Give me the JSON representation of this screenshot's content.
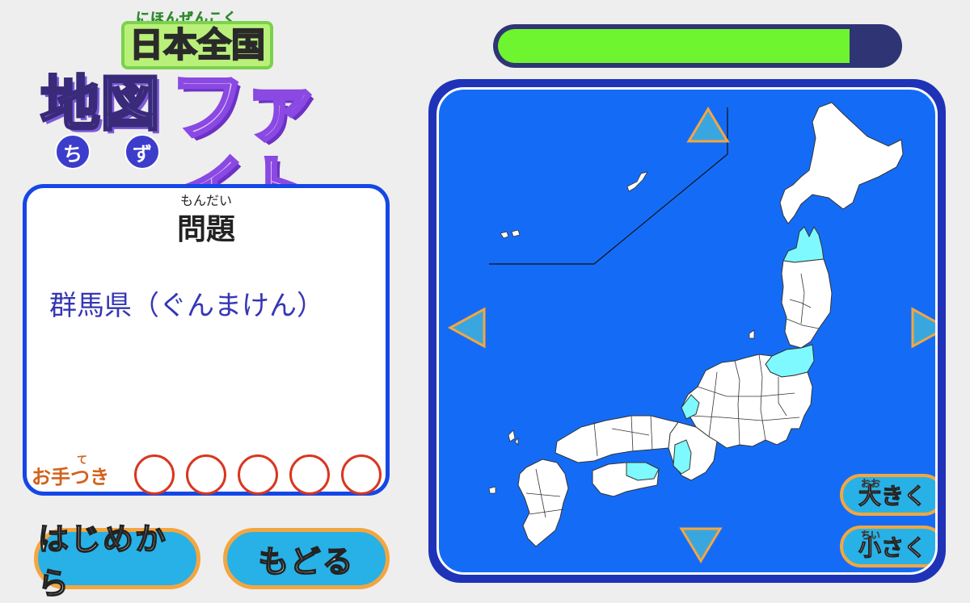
{
  "logo": {
    "ruby_top": "にほんぜんこく",
    "line1": "日本全国",
    "line2a": "地図",
    "line2b": "ファイト",
    "ruby_chi": "ち",
    "ruby_zu": "ず"
  },
  "panel": {
    "title_ruby": "もんだい",
    "title": "問題",
    "question": "群馬県（ぐんまけん）",
    "otetsuki_ruby": "て",
    "otetsuki_label": "お手つき",
    "miss_slots": 5
  },
  "buttons": {
    "restart": "はじめから",
    "back": "もどる",
    "zoom_in": "大きく",
    "zoom_in_ruby": "おお",
    "zoom_out": "小さく",
    "zoom_out_ruby": "ちい"
  },
  "progress": {
    "value": 0.88
  },
  "colors": {
    "ocean": "#146cf6",
    "land": "#ffffff",
    "highlight": "#7ef9ff",
    "accent_orange": "#f3a640",
    "button_blue": "#28b1e6",
    "progress_green": "#6ef52f"
  },
  "icons": {
    "up": "triangle-up-icon",
    "down": "triangle-down-icon",
    "left": "triangle-left-icon",
    "right": "triangle-right-icon"
  }
}
